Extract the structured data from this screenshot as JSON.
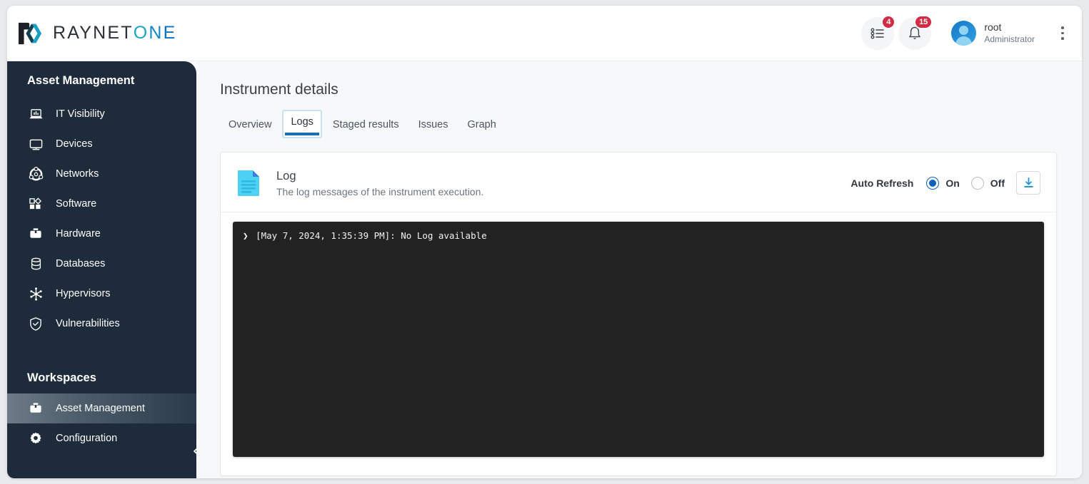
{
  "brand": {
    "name_dark": "RAYNET",
    "name_o": "O",
    "name_n": "N",
    "name_e": "E",
    "logo_icon": "raynet-logo-icon",
    "color_dark": "#2b3036",
    "color_teal": "#1aa5c4",
    "color_blue": "#0b6fc2"
  },
  "topbar": {
    "tasks": {
      "icon": "task-list-icon",
      "badge": "4"
    },
    "notifications": {
      "icon": "bell-icon",
      "badge": "15"
    },
    "user": {
      "name": "root",
      "role": "Administrator",
      "avatar_icon": "user-avatar-icon"
    },
    "overflow_menu_icon": "kebab-menu-icon",
    "badge_color": "#d32b42"
  },
  "sidebar": {
    "section_title": "Asset Management",
    "items": [
      {
        "label": "IT Visibility",
        "icon": "laptop-chart-icon"
      },
      {
        "label": "Devices",
        "icon": "monitor-icon"
      },
      {
        "label": "Networks",
        "icon": "network-nodes-icon"
      },
      {
        "label": "Software",
        "icon": "software-blocks-icon"
      },
      {
        "label": "Hardware",
        "icon": "toolbox-icon"
      },
      {
        "label": "Databases",
        "icon": "database-icon"
      },
      {
        "label": "Hypervisors",
        "icon": "hypervisor-star-icon"
      },
      {
        "label": "Vulnerabilities",
        "icon": "shield-check-icon"
      }
    ],
    "workspaces_title": "Workspaces",
    "workspaces": [
      {
        "label": "Asset Management",
        "icon": "briefcase-icon",
        "active": true
      },
      {
        "label": "Configuration",
        "icon": "gear-icon",
        "active": false
      }
    ],
    "collapse_icon": "chevron-left-icon",
    "background": "#1d2b3a"
  },
  "main": {
    "page_title": "Instrument details",
    "tabs": [
      {
        "label": "Overview",
        "active": false
      },
      {
        "label": "Logs",
        "active": true
      },
      {
        "label": "Staged results",
        "active": false
      },
      {
        "label": "Issues",
        "active": false
      },
      {
        "label": "Graph",
        "active": false
      }
    ],
    "card": {
      "icon": "log-document-icon",
      "title": "Log",
      "subtitle": "The log messages of the instrument execution.",
      "auto_refresh_label": "Auto Refresh",
      "on_label": "On",
      "off_label": "Off",
      "auto_refresh_value": "On",
      "download_icon": "download-icon",
      "accent_color": "#0a63ba"
    },
    "terminal": {
      "prompt": "❯",
      "lines": [
        "[May 7, 2024, 1:35:39 PM]: No Log available"
      ],
      "background": "#222223",
      "text_color": "#f2f2f2"
    }
  }
}
